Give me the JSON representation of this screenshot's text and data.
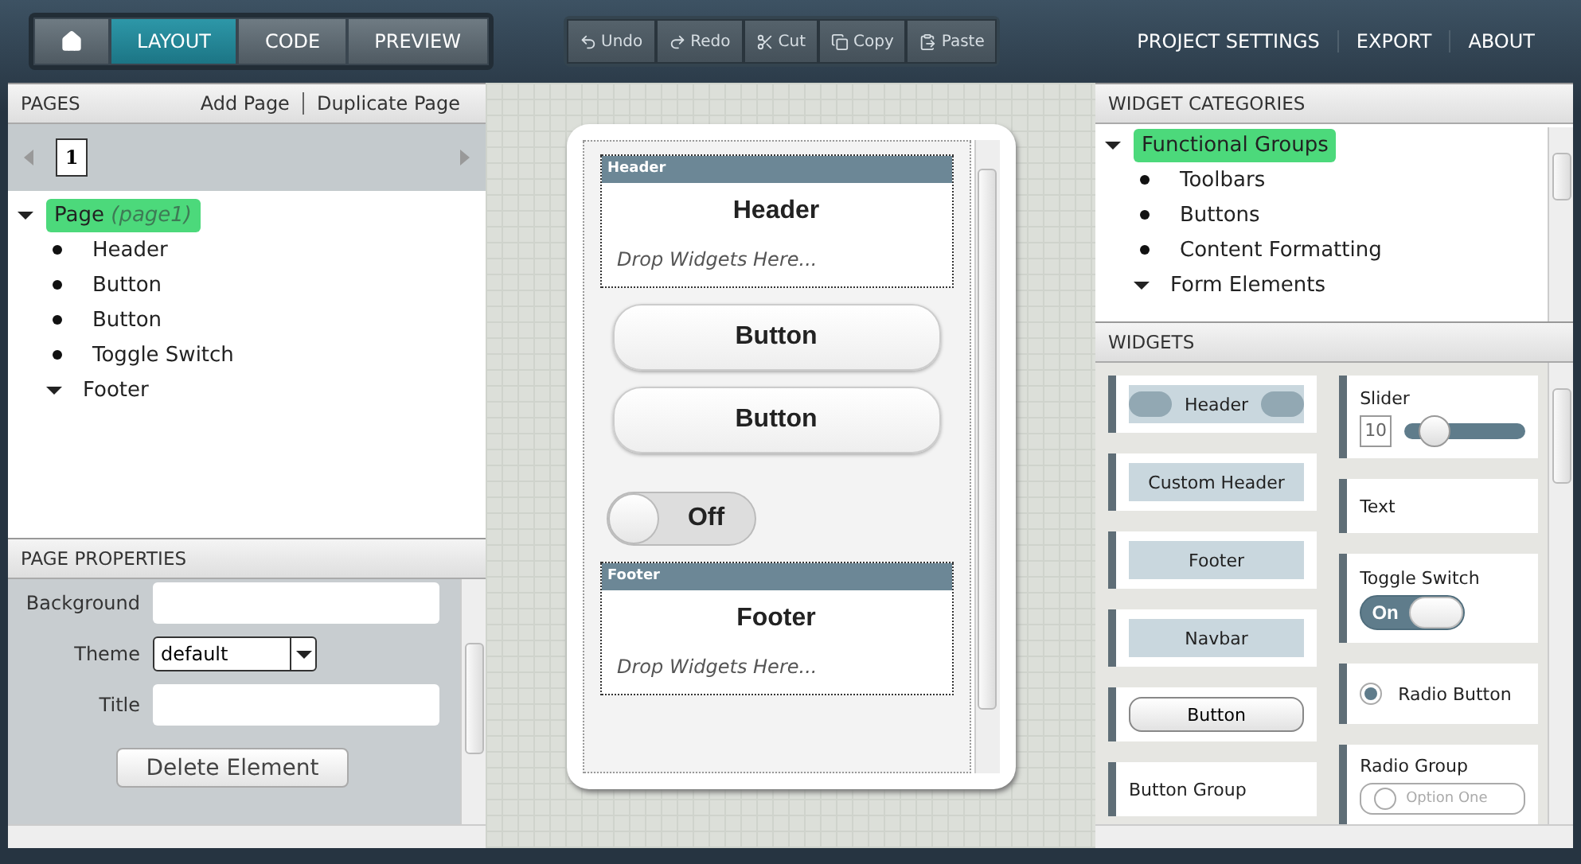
{
  "toolbar": {
    "nav_tabs": [
      {
        "kind": "home",
        "selected": false
      },
      {
        "kind": "text",
        "label": "LAYOUT",
        "selected": true
      },
      {
        "kind": "text",
        "label": "CODE",
        "selected": false
      },
      {
        "kind": "text",
        "label": "PREVIEW",
        "selected": false
      }
    ],
    "edit_buttons": [
      {
        "kind": "undo",
        "label": "Undo"
      },
      {
        "kind": "redo",
        "label": "Redo"
      },
      {
        "kind": "cut",
        "label": "Cut"
      },
      {
        "kind": "copy",
        "label": "Copy"
      },
      {
        "kind": "paste",
        "label": "Paste"
      }
    ],
    "links": [
      "PROJECT SETTINGS",
      "EXPORT",
      "ABOUT"
    ]
  },
  "pages_panel": {
    "title": "PAGES",
    "actions": [
      "Add Page",
      "Duplicate Page"
    ],
    "page_tabs": [
      {
        "label": "1",
        "selected": true
      }
    ],
    "tree": [
      {
        "kind": "group",
        "label": "Page",
        "note": "(page1)",
        "selected": true,
        "expanded": true,
        "children": [
          {
            "kind": "leaf",
            "label": "Header",
            "selected": false
          },
          {
            "kind": "leaf",
            "label": "Button",
            "selected": false
          },
          {
            "kind": "leaf",
            "label": "Button",
            "selected": false
          },
          {
            "kind": "leaf",
            "label": "Toggle Switch",
            "selected": false
          },
          {
            "kind": "group",
            "label": "Footer",
            "selected": false,
            "expanded": true
          }
        ]
      }
    ]
  },
  "properties_panel": {
    "title": "PAGE PROPERTIES",
    "fields": [
      {
        "kind": "text",
        "label": "Background"
      },
      {
        "kind": "select",
        "label": "Theme",
        "value": "default"
      },
      {
        "kind": "text",
        "label": "Title"
      }
    ],
    "button": "Delete Element"
  },
  "canvas": {
    "sections": [
      {
        "kind": "header",
        "tag": "Header",
        "title": "Header",
        "hint": "Drop Widgets Here..."
      },
      {
        "kind": "content",
        "items": [
          {
            "kind": "button",
            "label": "Button"
          },
          {
            "kind": "button",
            "label": "Button"
          },
          {
            "kind": "toggle",
            "label": "Off",
            "on": false
          }
        ]
      },
      {
        "kind": "footer",
        "tag": "Footer",
        "title": "Footer",
        "hint": "Drop Widgets Here..."
      }
    ]
  },
  "categories_panel": {
    "title": "WIDGET CATEGORIES",
    "tree": [
      {
        "kind": "group",
        "label": "Functional Groups",
        "selected": true,
        "expanded": true,
        "children": [
          {
            "kind": "leaf",
            "label": "Toolbars",
            "selected": false
          },
          {
            "kind": "leaf",
            "label": "Buttons",
            "selected": false
          },
          {
            "kind": "leaf",
            "label": "Content Formatting",
            "selected": false
          },
          {
            "kind": "group",
            "label": "Form Elements",
            "selected": false,
            "expanded": true
          }
        ]
      }
    ]
  },
  "widgets_panel": {
    "title": "WIDGETS",
    "columns": [
      [
        {
          "kind": "header",
          "label": "Header"
        },
        {
          "kind": "bar",
          "label": "Custom Header"
        },
        {
          "kind": "bar",
          "label": "Footer"
        },
        {
          "kind": "bar",
          "label": "Navbar"
        },
        {
          "kind": "button",
          "label": "Button"
        },
        {
          "kind": "caption",
          "label": "Button Group"
        }
      ],
      [
        {
          "kind": "slider",
          "label": "Slider",
          "value": "10",
          "level": 0.25
        },
        {
          "kind": "text",
          "label": "Text"
        },
        {
          "kind": "toggle",
          "label": "Toggle Switch",
          "state": "On",
          "on": true
        },
        {
          "kind": "radio",
          "label": "Radio Button",
          "selected": true
        },
        {
          "kind": "radio_group",
          "label": "Radio Group",
          "option": "Option One",
          "selected": false
        }
      ]
    ]
  }
}
